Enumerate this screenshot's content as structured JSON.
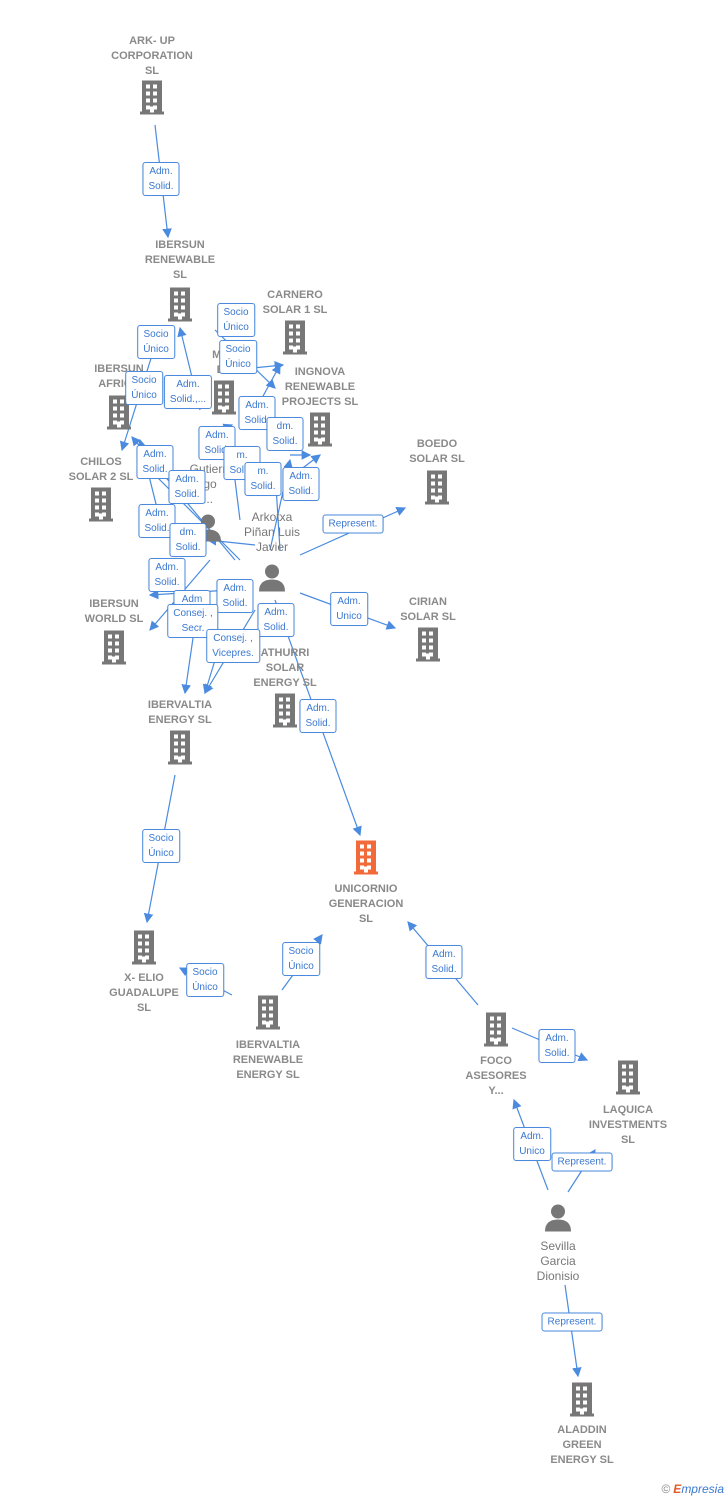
{
  "colors": {
    "edge": "#4a8be0",
    "node": "#777777",
    "focus_node": "#f26a3a",
    "label": "#8a8a8a"
  },
  "nodes": [
    {
      "type": "company",
      "lines": [
        "ARK- UP",
        "CORPORATION",
        "SL"
      ]
    },
    {
      "type": "company",
      "lines": [
        "IBERSUN",
        "RENEWABLE",
        "SL"
      ]
    },
    {
      "type": "company",
      "lines": [
        "CARNERO",
        "SOLAR 1  SL"
      ]
    },
    {
      "type": "company",
      "lines": [
        "IBERSUN",
        "AFRICA"
      ]
    },
    {
      "type": "company",
      "lines": [
        "MAL",
        "EV"
      ]
    },
    {
      "type": "company",
      "lines": [
        "INGNOVA",
        "RENEWABLE",
        "PROJECTS  SL"
      ]
    },
    {
      "type": "company",
      "lines": [
        "BOEDO",
        "SOLAR  SL"
      ]
    },
    {
      "type": "company",
      "lines": [
        "CHILOS",
        "SOLAR 2  SL"
      ]
    },
    {
      "type": "person",
      "lines": [
        "Gutierr",
        "rgo",
        "..."
      ]
    },
    {
      "type": "person",
      "lines": [
        "Arkotxa",
        "Piñan Luis",
        "Javier"
      ]
    },
    {
      "type": "company",
      "lines": [
        "IBERSUN",
        "WORLD  SL"
      ]
    },
    {
      "type": "company",
      "lines": [
        "CIRIAN",
        "SOLAR  SL"
      ]
    },
    {
      "type": "company",
      "lines": [
        "ATHURRI",
        "SOLAR",
        "ENERGY  SL"
      ]
    },
    {
      "type": "company",
      "lines": [
        "IBERVALTIA",
        "ENERGY  SL"
      ]
    },
    {
      "type": "focus",
      "lines": [
        "UNICORNIO",
        "GENERACION",
        "SL"
      ]
    },
    {
      "type": "company",
      "lines": [
        "X- ELIO",
        "GUADALUPE",
        "SL"
      ]
    },
    {
      "type": "company",
      "lines": [
        "IBERVALTIA",
        "RENEWABLE",
        "ENERGY  SL"
      ]
    },
    {
      "type": "company",
      "lines": [
        "FOCO",
        "ASESORES",
        "Y..."
      ]
    },
    {
      "type": "company",
      "lines": [
        "LAQUICA",
        "INVESTMENTS",
        "SL"
      ]
    },
    {
      "type": "person",
      "lines": [
        "Sevilla",
        "Garcia",
        "Dionisio"
      ]
    },
    {
      "type": "company",
      "lines": [
        "ALADDIN",
        "GREEN",
        "ENERGY  SL"
      ]
    }
  ],
  "edge_labels": [
    "Adm.\nSolid.",
    "Socio\nÚnico",
    "Socio\nÚnico",
    "Socio\nÚnico",
    "Socio\nÚnico",
    "Adm.\nSolid.,...",
    "Adm.\nSolid.",
    "Adm.\nSolid.",
    "dm.\nSolid.",
    "Adm.\nSolid.",
    "m.\nSolid.",
    "m.\nSolid.",
    "Adm.\nSolid.",
    "Adm.\nSolid.",
    "Represent.",
    "Adm.\nSolid.",
    "dm.\nSolid.",
    "Adm.\nSolid.",
    "Adm\nSolid.",
    "Adm.\nSolid.",
    "Adm.\nUnico",
    "Consej. ,\nSecr.",
    "Adm.\nSolid.",
    "Consej. ,\nVicepres.",
    "Adm.\nSolid.",
    "Socio\nÚnico",
    "Socio\nÚnico",
    "Socio\nÚnico",
    "Adm.\nSolid.",
    "Adm.\nSolid.",
    "Adm.\nUnico",
    "Represent.",
    "Represent."
  ],
  "footer": {
    "copyright": "©",
    "brand_initial": "E",
    "brand_rest": "mpresia"
  }
}
